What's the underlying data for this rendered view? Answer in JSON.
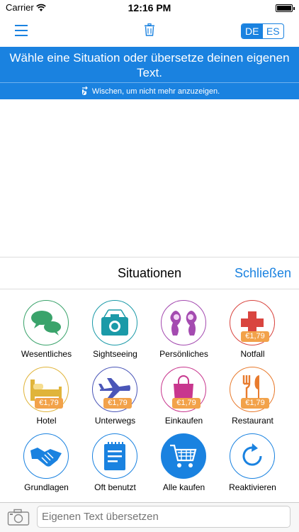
{
  "status": {
    "carrier": "Carrier",
    "time": "12:16 PM"
  },
  "nav": {
    "lang_from": "DE",
    "lang_to": "ES"
  },
  "banner": {
    "message": "Wähle eine Situation oder übersetze deinen eigenen Text.",
    "hint": "Wischen, um nicht mehr anzuzeigen."
  },
  "panel": {
    "title": "Situationen",
    "close": "Schließen",
    "tiles": [
      {
        "label": "Wesentliches",
        "color": "#3aa36b",
        "icon": "chat-bubbles-icon",
        "price": ""
      },
      {
        "label": "Sightseeing",
        "color": "#1b9aa8",
        "icon": "camera-icon",
        "price": ""
      },
      {
        "label": "Persönliches",
        "color": "#a44bb0",
        "icon": "people-icon",
        "price": ""
      },
      {
        "label": "Notfall",
        "color": "#d9453f",
        "icon": "medical-cross-icon",
        "price": "€1,79"
      },
      {
        "label": "Hotel",
        "color": "#e0b43a",
        "icon": "bed-icon",
        "price": "€1,79"
      },
      {
        "label": "Unterwegs",
        "color": "#4a56b8",
        "icon": "airplane-icon",
        "price": "€1,79"
      },
      {
        "label": "Einkaufen",
        "color": "#c8378e",
        "icon": "shopping-bag-icon",
        "price": "€1,79"
      },
      {
        "label": "Restaurant",
        "color": "#e87b2e",
        "icon": "fork-knife-icon",
        "price": "€1,79"
      },
      {
        "label": "Grundlagen",
        "color": "#1a82e0",
        "icon": "handshake-icon",
        "price": ""
      },
      {
        "label": "Oft benutzt",
        "color": "#1a82e0",
        "icon": "notepad-icon",
        "price": ""
      },
      {
        "label": "Alle kaufen",
        "color": "#1a82e0",
        "icon": "shopping-cart-icon",
        "price": ""
      },
      {
        "label": "Reaktivieren",
        "color": "#1a82e0",
        "icon": "refresh-icon",
        "price": ""
      }
    ]
  },
  "input": {
    "placeholder": "Eigenen Text übersetzen"
  }
}
